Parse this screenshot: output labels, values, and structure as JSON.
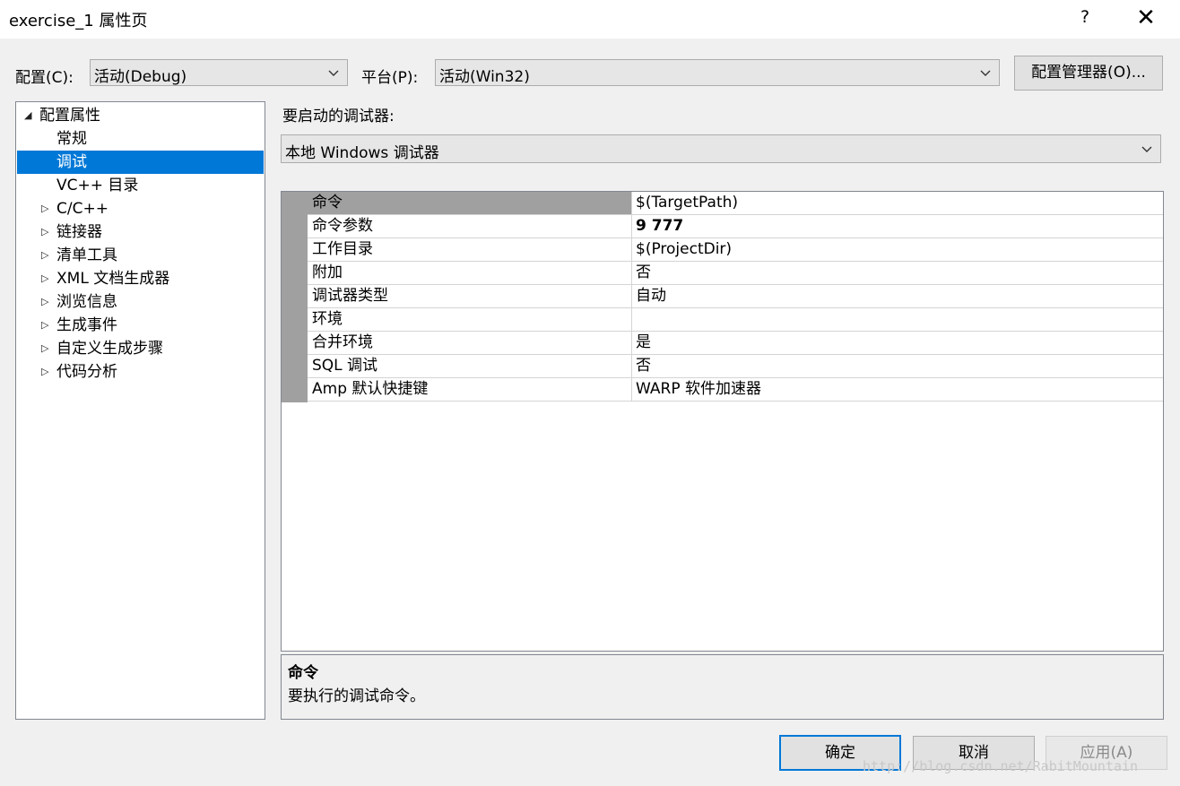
{
  "window": {
    "title": "exercise_1 属性页",
    "help_glyph": "?",
    "close_glyph": "✕"
  },
  "toolbar": {
    "config_label": "配置(C):",
    "config_value": "活动(Debug)",
    "platform_label": "平台(P):",
    "platform_value": "活动(Win32)",
    "config_manager_label": "配置管理器(O)..."
  },
  "tree": {
    "items": [
      {
        "label": "配置属性",
        "arrow": "◢"
      },
      {
        "label": "常规",
        "arrow": ""
      },
      {
        "label": "调试",
        "arrow": ""
      },
      {
        "label": "VC++ 目录",
        "arrow": ""
      },
      {
        "label": "C/C++",
        "arrow": "▷"
      },
      {
        "label": "链接器",
        "arrow": "▷"
      },
      {
        "label": "清单工具",
        "arrow": "▷"
      },
      {
        "label": "XML 文档生成器",
        "arrow": "▷"
      },
      {
        "label": "浏览信息",
        "arrow": "▷"
      },
      {
        "label": "生成事件",
        "arrow": "▷"
      },
      {
        "label": "自定义生成步骤",
        "arrow": "▷"
      },
      {
        "label": "代码分析",
        "arrow": "▷"
      }
    ],
    "selected_index": 2
  },
  "debugger": {
    "label": "要启动的调试器:",
    "value": "本地 Windows 调试器"
  },
  "grid": {
    "rows": [
      {
        "key": "命令",
        "value": "$(TargetPath)"
      },
      {
        "key": "命令参数",
        "value": "9 777"
      },
      {
        "key": "工作目录",
        "value": "$(ProjectDir)"
      },
      {
        "key": "附加",
        "value": "否"
      },
      {
        "key": "调试器类型",
        "value": "自动"
      },
      {
        "key": "环境",
        "value": ""
      },
      {
        "key": "合并环境",
        "value": "是"
      },
      {
        "key": "SQL 调试",
        "value": "否"
      },
      {
        "key": "Amp 默认快捷键",
        "value": "WARP 软件加速器"
      }
    ],
    "selected_index": 0,
    "bold_index": 1
  },
  "description": {
    "title": "命令",
    "text": "要执行的调试命令。"
  },
  "buttons": {
    "ok": "确定",
    "cancel": "取消",
    "apply": "应用(A)"
  },
  "watermark": "http://blog.csdn.net/RabitMountain",
  "colors": {
    "selection": "#0078d7",
    "gutter": "#a0a0a0",
    "dialog_bg": "#f0f0f0"
  }
}
